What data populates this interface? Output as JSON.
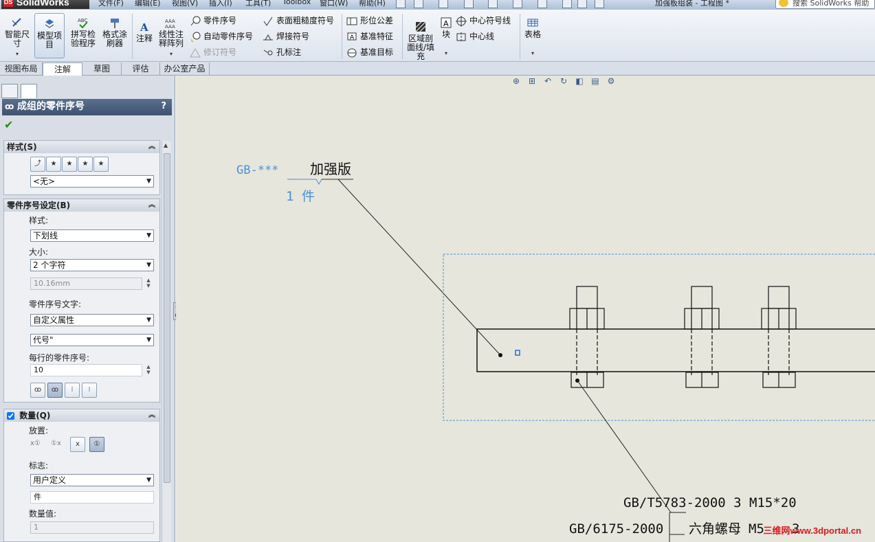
{
  "app": {
    "logo": "SolidWorks",
    "menu": [
      "文件(F)",
      "编辑(E)",
      "视图(V)",
      "插入(I)",
      "工具(T)",
      "Toolbox",
      "窗口(W)",
      "帮助(H)"
    ],
    "doc_title": "加强板组装 - 工程图 *",
    "help_search_placeholder": "搜索 SolidWorks 帮助"
  },
  "ribbon": {
    "smart_dim": "智能尺寸",
    "model_items": "模型项目",
    "spell_check": "拼写检验程序",
    "format_painter": "格式涂刷器",
    "note": "注释",
    "linear_pattern": "线性注释阵列",
    "balloon": "零件序号",
    "auto_balloon": "自动零件序号",
    "revision": "修订符号",
    "surface_finish": "表面粗糙度符号",
    "weld_symbol": "焊接符号",
    "hole_callout": "孔标注",
    "gtol": "形位公差",
    "datum_feature": "基准特征",
    "datum_target": "基准目标",
    "area_hatch": "区域剖面线/填充",
    "block": "块",
    "center_mark": "中心符号线",
    "centerline": "中心线",
    "table": "表格"
  },
  "tabs": [
    "视图布局",
    "注解",
    "草图",
    "评估",
    "办公室产品"
  ],
  "active_tab": 1,
  "property_manager": {
    "title": "成组的零件序号",
    "help": "?",
    "style_group": {
      "label": "样式(S)",
      "style_value": "<无>"
    },
    "balloon_settings": {
      "label": "零件序号设定(B)",
      "style_label": "样式:",
      "style_value": "下划线",
      "size_label": "大小:",
      "size_value": "2 个字符",
      "size_mm": "10.16mm",
      "text_label": "零件序号文字:",
      "text_value": "自定义属性",
      "property_value": "代号\"",
      "per_line_label": "每行的零件序号:",
      "per_line_value": "10"
    },
    "quantity": {
      "label": "数量(Q)",
      "placement_label": "放置:",
      "denotation_label": "标志:",
      "denotation_value": "用户定义",
      "unit_value": "件",
      "value_label": "数量值:",
      "value": "1"
    }
  },
  "drawing": {
    "label_code": "GB-***",
    "label_name": "加强版",
    "label_qty": "1  件",
    "bom_line1": "GB/T5783-2000  3  M15*20",
    "bom_line2": "GB/6175-2000",
    "bom_line2_name": "六角螺母",
    "bom_line2_spec": "M5",
    "bom_line2_qty": "3",
    "watermark": "三维网www.3dportal.cn"
  }
}
